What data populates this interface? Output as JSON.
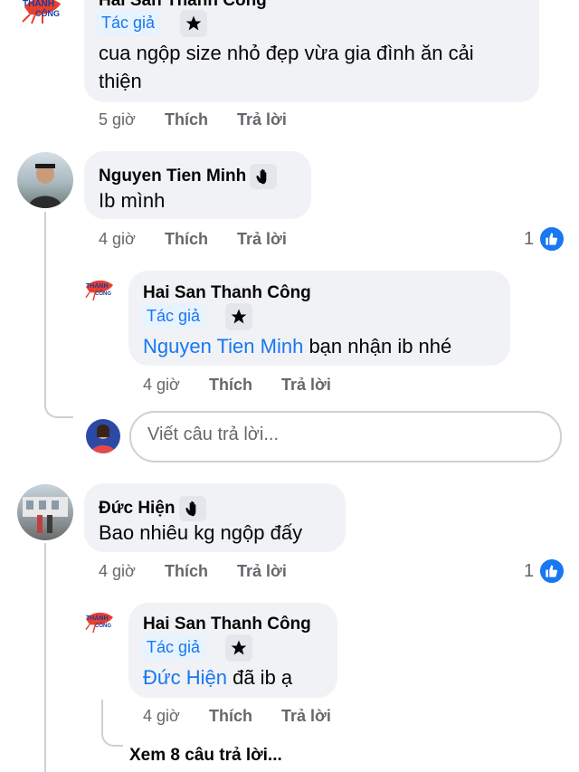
{
  "comments": [
    {
      "author": "Hai San Thanh Công",
      "badge": "Tác giả",
      "text_line1": "cua ngộp size nhỏ đẹp vừa gia đình ăn cải",
      "text_line2": "thiện",
      "time": "5 giờ",
      "like_action": "Thích",
      "reply_action": "Trả lời"
    },
    {
      "author": "Nguyen Tien Minh",
      "text": "Ib mình",
      "time": "4 giờ",
      "like_action": "Thích",
      "reply_action": "Trả lời",
      "like_count": "1",
      "reply": {
        "author": "Hai San Thanh Công",
        "badge": "Tác giả",
        "mention": "Nguyen Tien Minh",
        "text": " bạn nhận ib nhé",
        "time": "4 giờ",
        "like_action": "Thích",
        "reply_action": "Trả lời"
      }
    },
    {
      "author": "Đức Hiện",
      "text": "Bao nhiêu kg ngộp đấy",
      "time": "4 giờ",
      "like_action": "Thích",
      "reply_action": "Trả lời",
      "like_count": "1",
      "reply": {
        "author": "Hai San Thanh Công",
        "badge": "Tác giả",
        "mention": "Đức Hiện",
        "text": " đã ib ạ",
        "time": "4 giờ",
        "like_action": "Thích",
        "reply_action": "Trả lời"
      },
      "view_more": "Xem 8 câu trả lời..."
    }
  ],
  "reply_input": {
    "placeholder": "Viết câu trả lời..."
  },
  "logo_text": "THÀNH CÔNG",
  "colors": {
    "accent": "#1877f2",
    "bubble": "#f0f2f5",
    "meta": "#65676b",
    "badge_bg": "#e7f3ff"
  },
  "icons": [
    "star-icon",
    "wave-icon",
    "like-thumb-icon"
  ]
}
